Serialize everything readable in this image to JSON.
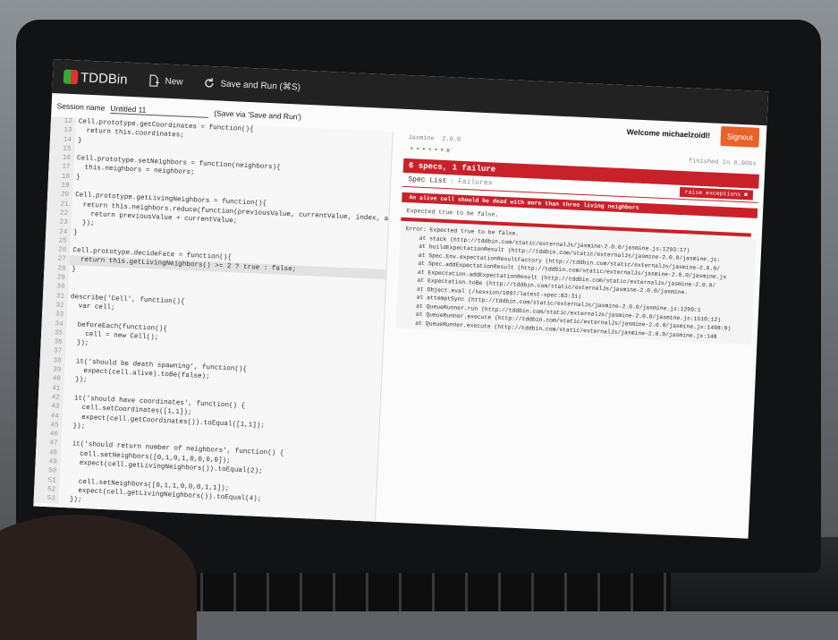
{
  "app": {
    "logo_text": "TDDBin",
    "new_label": "New",
    "save_run_label": "Save and Run (⌘S)"
  },
  "session": {
    "label": "Session name",
    "value": "Untitled 11",
    "hint": "(Save via 'Save and Run')"
  },
  "user": {
    "welcome": "Welcome michaelzoidl!",
    "signout_label": "Signout"
  },
  "editor_lines": [
    {
      "n": "12",
      "code": "Cell.prototype.getCoordinates = function(){"
    },
    {
      "n": "13",
      "code": "  return this.coordinates;"
    },
    {
      "n": "14",
      "code": "}"
    },
    {
      "n": "15",
      "code": ""
    },
    {
      "n": "16",
      "code": "Cell.prototype.setNeighbors = function(neighbors){"
    },
    {
      "n": "17",
      "code": "  this.neighbors = neighbors;"
    },
    {
      "n": "18",
      "code": "}"
    },
    {
      "n": "19",
      "code": ""
    },
    {
      "n": "20",
      "code": "Cell.prototype.getLivingNeighbors = function(){"
    },
    {
      "n": "21",
      "code": "  return this.neighbors.reduce(function(previousValue, currentValue, index, array){"
    },
    {
      "n": "22",
      "code": "    return previousValue + currentValue;"
    },
    {
      "n": "23",
      "code": "  });"
    },
    {
      "n": "24",
      "code": "}"
    },
    {
      "n": "25",
      "code": ""
    },
    {
      "n": "26",
      "code": "Cell.prototype.decideFate = function(){"
    },
    {
      "n": "27",
      "code": "  return this.getLivingNeighbors() >= 2 ? true : false;"
    },
    {
      "n": "28",
      "code": "}"
    },
    {
      "n": "29",
      "code": ""
    },
    {
      "n": "30",
      "code": ""
    },
    {
      "n": "31",
      "code": "describe('Cell', function(){"
    },
    {
      "n": "32",
      "code": "  var cell;"
    },
    {
      "n": "33",
      "code": ""
    },
    {
      "n": "34",
      "code": "  beforeEach(function(){"
    },
    {
      "n": "35",
      "code": "    cell = new Cell();"
    },
    {
      "n": "36",
      "code": "  });"
    },
    {
      "n": "37",
      "code": ""
    },
    {
      "n": "38",
      "code": "  it('should be death spawning', function(){"
    },
    {
      "n": "39",
      "code": "    expect(cell.alive).toBe(false);"
    },
    {
      "n": "40",
      "code": "  });"
    },
    {
      "n": "41",
      "code": ""
    },
    {
      "n": "42",
      "code": "  it('should have coordinates', function() {"
    },
    {
      "n": "43",
      "code": "    cell.setCoordinates([1,1]);"
    },
    {
      "n": "44",
      "code": "    expect(cell.getCoordinates()).toEqual([1,1]);"
    },
    {
      "n": "45",
      "code": "  });"
    },
    {
      "n": "46",
      "code": ""
    },
    {
      "n": "47",
      "code": "  it('should return number of neighbors', function() {"
    },
    {
      "n": "48",
      "code": "    cell.setNeighbors([0,1,0,1,0,0,0,0]);"
    },
    {
      "n": "49",
      "code": "    expect(cell.getLivingNeighbors()).toEqual(2);"
    },
    {
      "n": "50",
      "code": ""
    },
    {
      "n": "51",
      "code": "    cell.setNeighbors([0,1,1,0,0,0,1,1]);"
    },
    {
      "n": "52",
      "code": "    expect(cell.getLivingNeighbors()).toEqual(4);"
    },
    {
      "n": "53",
      "code": "  });"
    }
  ],
  "jasmine": {
    "name": "Jasmine",
    "version": "2.0.0",
    "dots": "••••••",
    "fail_mark": "x",
    "finished": "finished in 0.006s",
    "summary": "6 specs, 1 failure",
    "tab_specs": "Spec List",
    "tab_sep": "|",
    "tab_failures": "Failures",
    "raise_exceptions": "raise exceptions",
    "failed_spec": "An alive cell should be dead with more than three living neighbors",
    "message": "Expected true to be false.",
    "stack": [
      "Error: Expected true to be false.",
      "    at stack (http://tddbin.com/static/externalJs/jasmine-2.0.0/jasmine.js:1293:17)",
      "    at buildExpectationResult (http://tddbin.com/static/externalJs/jasmine-2.0.0/jasmine.js:",
      "    at Spec.Env.expectationResultFactory (http://tddbin.com/static/externalJs/jasmine-2.0.0/",
      "    at Spec.addExpectationResult (http://tddbin.com/static/externalJs/jasmine-2.0.0/jasmine.js",
      "    at Expectation.addExpectationResult (http://tddbin.com/static/externalJs/jasmine-2.0.0/",
      "    at Expectation.toBe (http://tddbin.com/static/externalJs/jasmine-2.0.0/jasmine.",
      "    at Object.eval (/session/1007/latest-spec:83:31)",
      "    at attemptSync (http://tddbin.com/static/externalJs/jasmine-2.0.0/jasmine.js:1209:1",
      "    at QueueRunner.run (http://tddbin.com/static/externalJs/jasmine-2.0.0/jasmine.js:1510:12)",
      "    at QueueRunner.execute (http://tddbin.com/static/externalJs/jasmine-2.0.0/jasmine.js:1498:9)",
      "    at QueueRunner.execute (http://tddbin.com/static/externalJs/jasmine-2.0.0/jasmine.js:148"
    ]
  },
  "colors": {
    "accent": "#e8622a",
    "failure": "#c8212a",
    "pass": "#2a9a2a"
  }
}
